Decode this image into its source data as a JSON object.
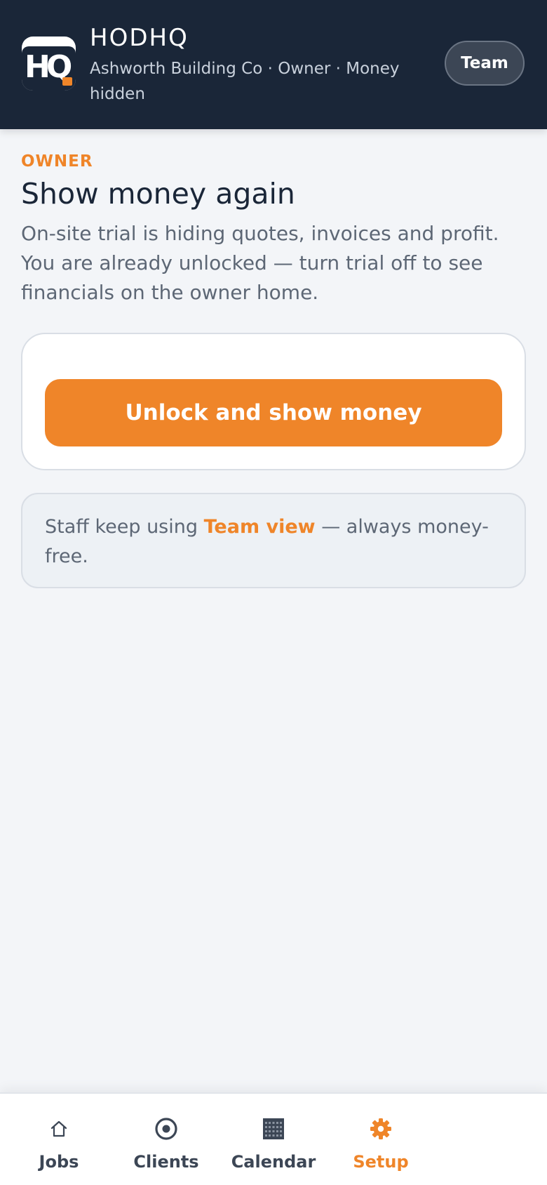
{
  "header": {
    "logo_text": "HQ",
    "title": "HODHQ",
    "subtitle": "Ashworth Building Co · Owner · Money hidden",
    "team_button": "Team"
  },
  "main": {
    "eyebrow": "OWNER",
    "title": "Show money again",
    "description": "On-site trial is hiding quotes, invoices and profit. You are already unlocked — turn trial off to see financials on the owner home.",
    "unlock_button": "Unlock and show money",
    "note": {
      "prefix": "Staff keep using ",
      "link": "Team view",
      "suffix": " — always money-free."
    }
  },
  "bottom_nav": {
    "items": [
      {
        "label": "Jobs",
        "icon": "home-icon",
        "active": false
      },
      {
        "label": "Clients",
        "icon": "target-icon",
        "active": false
      },
      {
        "label": "Calendar",
        "icon": "calendar-grid-icon",
        "active": false
      },
      {
        "label": "Setup",
        "icon": "gear-icon",
        "active": true
      }
    ]
  },
  "colors": {
    "header_bg": "#1a2638",
    "accent": "#ef8529",
    "page_bg": "#f3f5f8",
    "text_muted": "#5d6775"
  }
}
